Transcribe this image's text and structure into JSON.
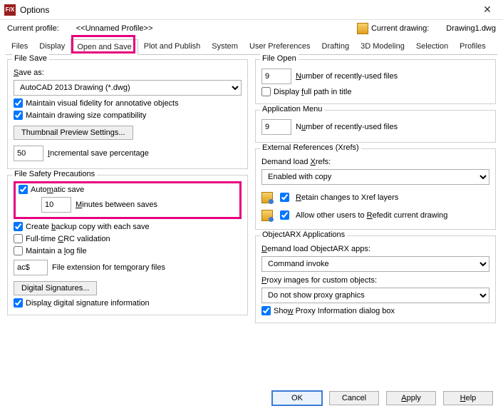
{
  "window": {
    "title": "Options"
  },
  "profile": {
    "label": "Current profile:",
    "value": "<<Unnamed Profile>>",
    "drawing_label": "Current drawing:",
    "drawing_value": "Drawing1.dwg"
  },
  "tabs": [
    "Files",
    "Display",
    "Open and Save",
    "Plot and Publish",
    "System",
    "User Preferences",
    "Drafting",
    "3D Modeling",
    "Selection",
    "Profiles"
  ],
  "file_save": {
    "title": "File Save",
    "save_as_label": "Save as:",
    "save_as_value": "AutoCAD 2013 Drawing (*.dwg)",
    "maintain_vis": "Maintain visual fidelity for annotative objects",
    "maintain_size": "Maintain drawing size compatibility",
    "thumb_btn": "Thumbnail Preview Settings...",
    "inc_value": "50",
    "inc_label": "Incremental save percentage"
  },
  "file_safety": {
    "title": "File Safety Precautions",
    "auto_save": "Automatic save",
    "mins_value": "10",
    "mins_label": "Minutes between saves",
    "backup": "Create backup copy with each save",
    "crc": "Full-time CRC validation",
    "logfile": "Maintain a log file",
    "ext_value": "ac$",
    "ext_label": "File extension for temporary files",
    "sig_btn": "Digital Signatures...",
    "disp_sig": "Display digital signature information"
  },
  "file_open": {
    "title": "File Open",
    "recent_value": "9",
    "recent_label": "Number of recently-used files",
    "full_path": "Display full path in title"
  },
  "app_menu": {
    "title": "Application Menu",
    "recent_value": "9",
    "recent_label": "Number of recently-used files"
  },
  "xrefs": {
    "title": "External References (Xrefs)",
    "demand_label": "Demand load Xrefs:",
    "demand_value": "Enabled with copy",
    "retain": "Retain changes to Xref layers",
    "allow": "Allow other users to Refedit current drawing"
  },
  "arx": {
    "title": "ObjectARX Applications",
    "demand_label": "Demand load ObjectARX apps:",
    "demand_value": "Command invoke",
    "proxy_label": "Proxy images for custom objects:",
    "proxy_value": "Do not show proxy graphics",
    "show_proxy": "Show Proxy Information dialog box"
  },
  "buttons": {
    "ok": "OK",
    "cancel": "Cancel",
    "apply": "Apply",
    "help": "Help"
  }
}
